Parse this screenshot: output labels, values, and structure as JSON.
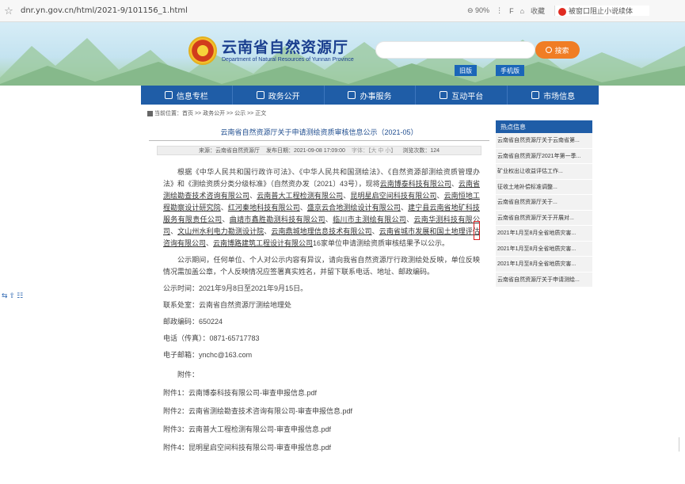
{
  "browser": {
    "url": "dnr.yn.gov.cn/html/2021-9/101156_1.html",
    "zoom": "90%",
    "tools": [
      "⊖ 90%",
      "⋮",
      "F",
      "⌂",
      "收藏"
    ],
    "search_engine": "被窗口阻止小说续体"
  },
  "header": {
    "title": "云南省自然资源厅",
    "subtitle": "Department of Natural Resources of Yunnan Province",
    "search_placeholder": "",
    "search_button": "搜索",
    "link_old": "旧版",
    "link_mobile": "手机版"
  },
  "nav": {
    "items": [
      {
        "label": "信息专栏",
        "icon": "info-icon"
      },
      {
        "label": "政务公开",
        "icon": "gov-icon"
      },
      {
        "label": "办事服务",
        "icon": "service-icon"
      },
      {
        "label": "互动平台",
        "icon": "chat-icon"
      },
      {
        "label": "市场信息",
        "icon": "chart-icon"
      }
    ]
  },
  "breadcrumb": "当前位置：首页 >> 政务公开 >> 公示 >> 正文",
  "article": {
    "title": "云南省自然资源厅关于申请测绘资质审核信息公示（2021-05）",
    "meta": {
      "source": "来源：云南省自然资源厅",
      "date": "发布日期：2021-09-08 17:09:00",
      "font": "字体：【大 中 小】",
      "views": "浏览次数：124"
    },
    "para1_intro": "根据《中华人民共和国行政许可法》、《中华人民共和国测绘法》、《自然资源部测绘资质管理办法》和《测绘资质分类分级标准》（自然资办发〔2021〕43号），现将",
    "companies": [
      "云南博泰科技有限公司",
      "云南省测绘勘查技术咨询有限公司",
      "云南普大工程检测有限公司",
      "昆明星启空间科技有限公司",
      "云南恒地工程勘察设计研究院",
      "红河秦地科技有限公司",
      "盛京云合地测绘设计有限公司",
      "建宁县云南省地矿科技服务有限责任公司",
      "曲靖市鑫胜勘测科技有限公司",
      "临川市主测绘有限公司",
      "云南华测科技有限公司",
      "文山州水利电力勘测设计院",
      "云南鼎城地理信息技术有限公司",
      "云南省城市发展和国土地理评估咨询有限公司",
      "云南博路建筑工程设计有限公司"
    ],
    "para1_outro": "16家单位申请测绘资质审核结果予以公示。",
    "para2": "公示期间，任何单位、个人对公示内容有异议，请向我省自然资源厅行政测绘处反映，单位反映情况需加盖公章，个人反映情况应签署真实姓名，并留下联系电话、地址、邮政编码。",
    "lines": [
      "公示时间：2021年9月8日至2021年9月15日。",
      "联系处室：云南省自然资源厅测绘地理处",
      "邮政编码：650224",
      "电话（传真）：0871-65717783",
      "电子邮箱：ynchc@163.com"
    ],
    "attach_label": "附件：",
    "attachments": [
      "附件1：云南博泰科技有限公司-审查申报信息.pdf",
      "附件2：云南省测绘勘查技术咨询有限公司-审查申报信息.pdf",
      "附件3：云南普大工程检测有限公司-审查申报信息.pdf",
      "附件4：昆明星启空间科技有限公司-审查申报信息.pdf"
    ]
  },
  "sidebar": {
    "heading": "热点信息",
    "items": [
      "云南省自然资源厅关于云南省第...",
      "云南省自然资源厅2021年第一季...",
      "矿业权出让收益评估工作...",
      "征收土地补偿标准调整...",
      "云南省自然资源厅关于...",
      "云南省自然资源厅关于开展对...",
      "2021年1月至8月全省地质灾害...",
      "2021年1月至8月全省地质灾害...",
      "2021年1月至8月全省地质灾害...",
      "云南省自然资源厅关于申请测绘..."
    ]
  },
  "float_tools": [
    "⇆",
    "⇧",
    "☷"
  ],
  "colors": {
    "nav_blue": "#1f5da7",
    "accent_orange": "#f07d24",
    "title_blue": "#1b3f8f",
    "highlight_red": "#d82020"
  }
}
